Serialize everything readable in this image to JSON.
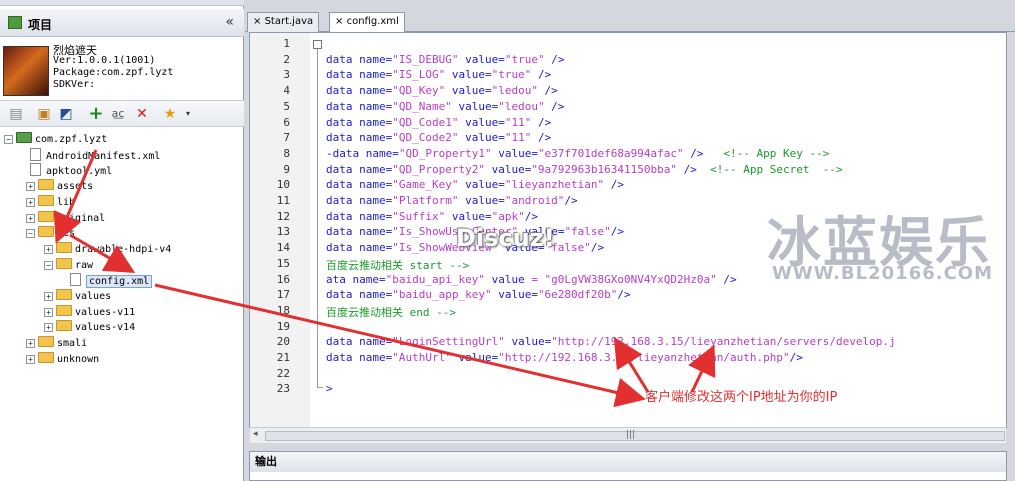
{
  "left_panel": {
    "title": "项目",
    "collapse_glyph": "«",
    "project": {
      "name": "烈焰遮天",
      "ver": "Ver:1.0.0.1(1001)",
      "package": "Package:com.zpf.lyzt",
      "sdkver": "SDKVer:"
    },
    "toolbar_icons": [
      "document-icon",
      "image-icon",
      "window-icon",
      "add-icon",
      "spell-icon",
      "delete-icon",
      "star-icon"
    ],
    "tree": [
      {
        "label": "com.zpf.lyzt",
        "pm": "−"
      },
      {
        "label": "AndroidManifest.xml"
      },
      {
        "label": "apktool.yml"
      },
      {
        "label": "assets",
        "pm": "+"
      },
      {
        "label": "lib",
        "pm": "+"
      },
      {
        "label": "original",
        "pm": "+"
      },
      {
        "label": "res",
        "pm": "−"
      },
      {
        "label": "drawable-hdpi-v4",
        "pm": "+"
      },
      {
        "label": "raw",
        "pm": "−"
      },
      {
        "label": "config.xml"
      },
      {
        "label": "values",
        "pm": "+"
      },
      {
        "label": "values-v11",
        "pm": "+"
      },
      {
        "label": "values-v14",
        "pm": "+"
      },
      {
        "label": "smali",
        "pm": "+"
      },
      {
        "label": "unknown",
        "pm": "+"
      }
    ]
  },
  "tabs": [
    {
      "label": "Start.java",
      "close": "×"
    },
    {
      "label": "config.xml",
      "close": "×"
    }
  ],
  "editor": {
    "line_numbers": [
      "1",
      "2",
      "3",
      "4",
      "5",
      "6",
      "7",
      "8",
      "9",
      "10",
      "11",
      "12",
      "13",
      "14",
      "15",
      "16",
      "17",
      "18",
      "19",
      "20",
      "21",
      "22",
      "23"
    ],
    "lines": [
      {
        "s": [
          [
            "b",
            ""
          ]
        ]
      },
      {
        "s": [
          [
            "t",
            "data name="
          ],
          [
            "v",
            "\"IS_DEBUG\""
          ],
          [
            "t",
            " value="
          ],
          [
            "v",
            "\"true\""
          ],
          [
            "t",
            " />"
          ]
        ]
      },
      {
        "s": [
          [
            "t",
            "data name="
          ],
          [
            "v",
            "\"IS_LOG\""
          ],
          [
            "t",
            " value="
          ],
          [
            "v",
            "\"true\""
          ],
          [
            "t",
            " />"
          ]
        ]
      },
      {
        "s": [
          [
            "t",
            "data name="
          ],
          [
            "v",
            "\"QD_Key\""
          ],
          [
            "t",
            " value="
          ],
          [
            "v",
            "\"ledou\""
          ],
          [
            "t",
            " />"
          ]
        ]
      },
      {
        "s": [
          [
            "t",
            "data name="
          ],
          [
            "v",
            "\"QD_Name\""
          ],
          [
            "t",
            " value="
          ],
          [
            "v",
            "\"ledou\""
          ],
          [
            "t",
            " />"
          ]
        ]
      },
      {
        "s": [
          [
            "t",
            "data name="
          ],
          [
            "v",
            "\"QD_Code1\""
          ],
          [
            "t",
            " value="
          ],
          [
            "v",
            "\"11\""
          ],
          [
            "t",
            " />"
          ]
        ]
      },
      {
        "s": [
          [
            "t",
            "data name="
          ],
          [
            "v",
            "\"QD_Code2\""
          ],
          [
            "t",
            " value="
          ],
          [
            "v",
            "\"11\""
          ],
          [
            "t",
            " />"
          ]
        ]
      },
      {
        "s": [
          [
            "t",
            "-data name="
          ],
          [
            "v",
            "\"QD_Property1\""
          ],
          [
            "t",
            " value="
          ],
          [
            "v",
            "\"e37f701def68a994afac\""
          ],
          [
            "t",
            " />   "
          ],
          [
            "c",
            "<!-- App Key -->"
          ]
        ]
      },
      {
        "s": [
          [
            "t",
            "data name="
          ],
          [
            "v",
            "\"QD_Property2\""
          ],
          [
            "t",
            " value="
          ],
          [
            "v",
            "\"9a792963b16341150bba\""
          ],
          [
            "t",
            " />  "
          ],
          [
            "c",
            "<!-- App Secret  -->"
          ]
        ]
      },
      {
        "s": [
          [
            "t",
            "data name="
          ],
          [
            "v",
            "\"Game_Key\""
          ],
          [
            "t",
            " value="
          ],
          [
            "v",
            "\"lieyanzhetian\""
          ],
          [
            "t",
            " />"
          ]
        ]
      },
      {
        "s": [
          [
            "t",
            "data name="
          ],
          [
            "v",
            "\"Platform\""
          ],
          [
            "t",
            " value="
          ],
          [
            "v",
            "\"android\""
          ],
          [
            "t",
            "/>"
          ]
        ]
      },
      {
        "s": [
          [
            "t",
            "data name="
          ],
          [
            "v",
            "\"Suffix\""
          ],
          [
            "t",
            " value="
          ],
          [
            "v",
            "\"apk\""
          ],
          [
            "t",
            "/>"
          ]
        ]
      },
      {
        "s": [
          [
            "t",
            "data name="
          ],
          [
            "v",
            "\"Is_ShowUserCenter\""
          ],
          [
            "t",
            " value="
          ],
          [
            "v",
            "\"false\""
          ],
          [
            "t",
            "/>"
          ]
        ]
      },
      {
        "s": [
          [
            "t",
            "data name="
          ],
          [
            "v",
            "\"Is_ShowWebView\""
          ],
          [
            "t",
            " value="
          ],
          [
            "v",
            "\"false\""
          ],
          [
            "t",
            "/>"
          ]
        ]
      },
      {
        "s": [
          [
            "c",
            "百度云推动相关 start -->"
          ]
        ]
      },
      {
        "s": [
          [
            "t",
            "ata name="
          ],
          [
            "v",
            "\"baidu_api_key\""
          ],
          [
            "t",
            " value "
          ],
          [
            "v",
            "= \"g0LgVW38GXo0NV4YxQD2Hz0a\""
          ],
          [
            "t",
            " />"
          ]
        ]
      },
      {
        "s": [
          [
            "t",
            "data name="
          ],
          [
            "v",
            "\"baidu_app_key\""
          ],
          [
            "t",
            " value="
          ],
          [
            "v",
            "\"6e280df20b\""
          ],
          [
            "t",
            "/>"
          ]
        ]
      },
      {
        "s": [
          [
            "c",
            "百度云推动相关 end -->"
          ]
        ]
      },
      {
        "s": [
          [
            "b",
            ""
          ]
        ]
      },
      {
        "s": [
          [
            "t",
            "data name="
          ],
          [
            "v",
            "\"LoginSettingUrl\""
          ],
          [
            "t",
            " value="
          ],
          [
            "v",
            "\"http://192.168.3.15/lieyanzhetian/servers/develop.j"
          ]
        ]
      },
      {
        "s": [
          [
            "t",
            "data name="
          ],
          [
            "v",
            "\"AuthUrl\""
          ],
          [
            "t",
            " value="
          ],
          [
            "v",
            "\"http://192.168.3.15/lieyanzhetian/auth.php\""
          ],
          [
            "t",
            "/>"
          ]
        ]
      },
      {
        "s": [
          [
            "b",
            ""
          ]
        ]
      },
      {
        "s": [
          [
            "t",
            ">"
          ]
        ]
      }
    ]
  },
  "scroll_grip": "|||",
  "output_panel": {
    "title": "输出"
  },
  "watermark": {
    "big": "冰蓝娱乐",
    "url": "WWW.BL20166.COM"
  },
  "discuz": "Discuz!",
  "annotation": "客户端修改这两个IP地址为你的IP",
  "colors": {
    "annotation_red": "#e23030",
    "tag_blue": "#1d1bd0",
    "value_purple": "#b73dc7",
    "comment_green": "#1a9a2a"
  }
}
